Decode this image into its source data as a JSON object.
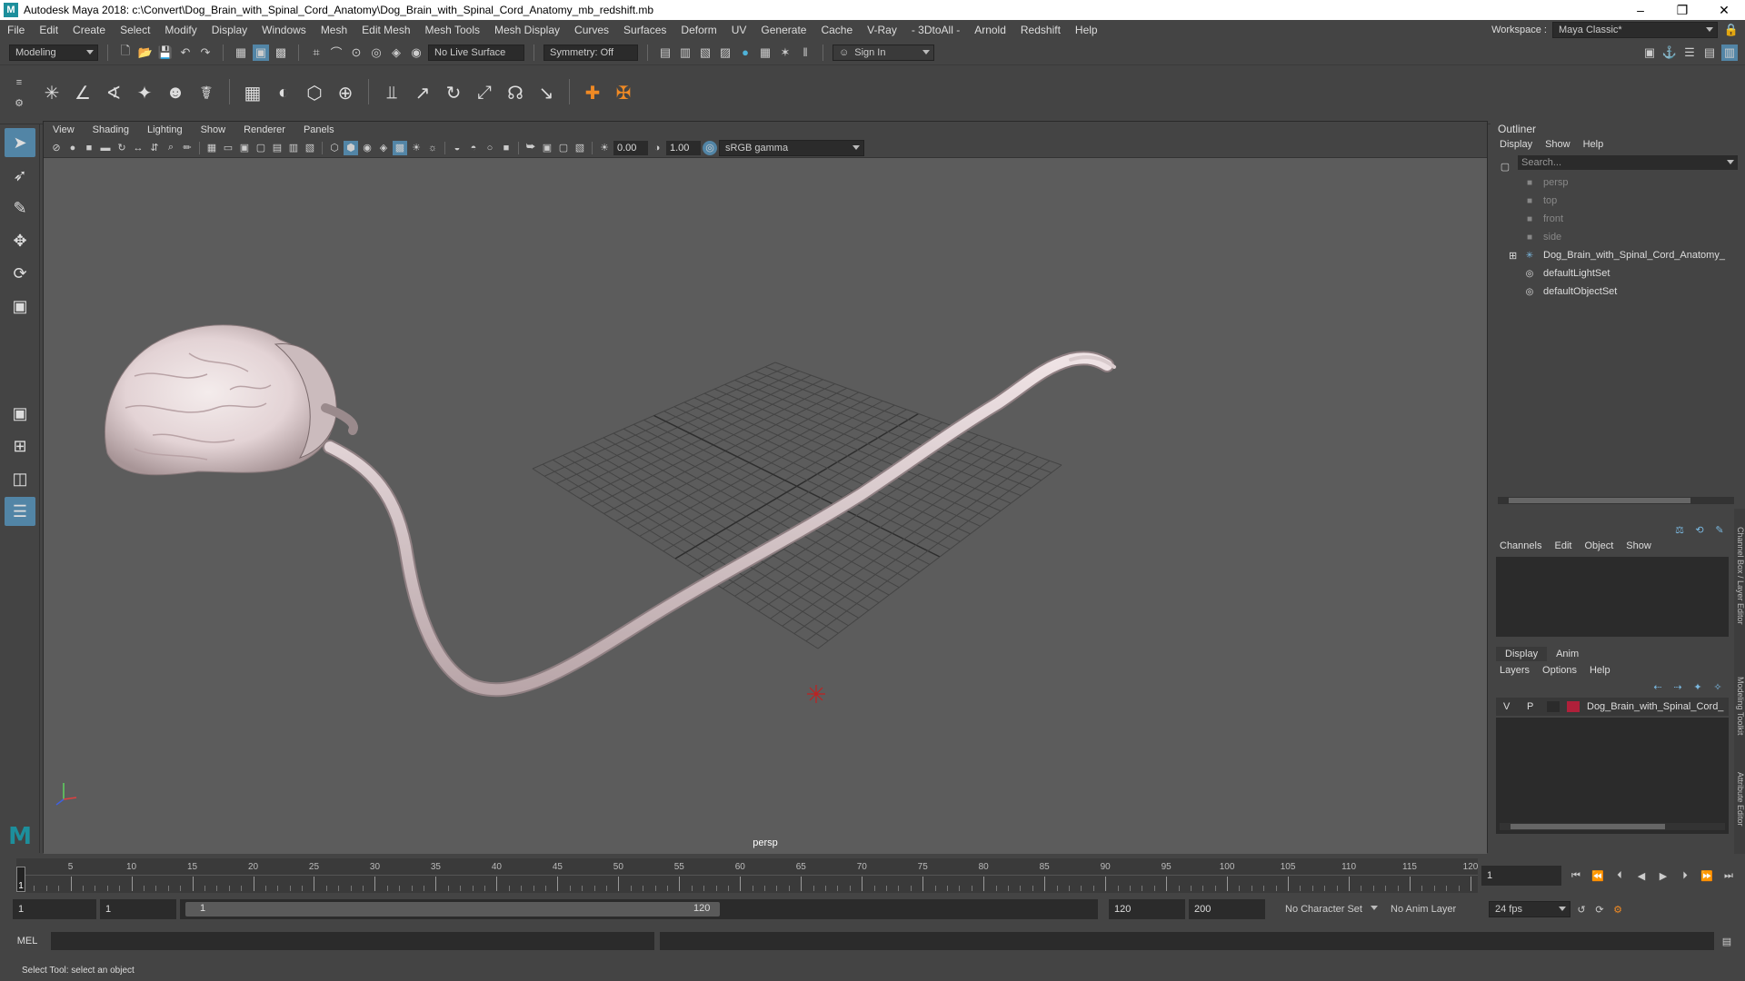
{
  "title": "Autodesk Maya 2018: c:\\Convert\\Dog_Brain_with_Spinal_Cord_Anatomy\\Dog_Brain_with_Spinal_Cord_Anatomy_mb_redshift.mb",
  "window_buttons": [
    "–",
    "❐",
    "✕"
  ],
  "menu": [
    "File",
    "Edit",
    "Create",
    "Select",
    "Modify",
    "Display",
    "Windows",
    "Mesh",
    "Edit Mesh",
    "Mesh Tools",
    "Mesh Display",
    "Curves",
    "Surfaces",
    "Deform",
    "UV",
    "Generate",
    "Cache",
    "V-Ray",
    "- 3DtoAll -",
    "Arnold",
    "Redshift",
    "Help"
  ],
  "workspace": {
    "label": "Workspace :",
    "value": "Maya Classic*"
  },
  "statusline": {
    "mode": "Modeling",
    "live_surface": "No Live Surface",
    "symmetry": "Symmetry: Off",
    "sign_in": "Sign In"
  },
  "viewport": {
    "menu": [
      "View",
      "Shading",
      "Lighting",
      "Show",
      "Renderer",
      "Panels"
    ],
    "exposure": "0.00",
    "gamma": "1.00",
    "color_space": "sRGB gamma",
    "camera": "persp"
  },
  "outliner": {
    "title": "Outliner",
    "menu": [
      "Display",
      "Show",
      "Help"
    ],
    "search_placeholder": "Search...",
    "items": [
      {
        "label": "persp",
        "icon": "camera-icon",
        "dim": true
      },
      {
        "label": "top",
        "icon": "camera-icon",
        "dim": true
      },
      {
        "label": "front",
        "icon": "camera-icon",
        "dim": true
      },
      {
        "label": "side",
        "icon": "camera-icon",
        "dim": true
      },
      {
        "label": "Dog_Brain_with_Spinal_Cord_Anatomy_",
        "icon": "transform-icon",
        "dim": false
      },
      {
        "label": "defaultLightSet",
        "icon": "set-icon",
        "dim": false
      },
      {
        "label": "defaultObjectSet",
        "icon": "set-icon",
        "dim": false
      }
    ]
  },
  "channelbox": {
    "menu": [
      "Channels",
      "Edit",
      "Object",
      "Show"
    ]
  },
  "layereditor": {
    "tabs": [
      "Display",
      "Anim"
    ],
    "menu": [
      "Layers",
      "Options",
      "Help"
    ],
    "layer": {
      "v": "V",
      "p": "P",
      "name": "Dog_Brain_with_Spinal_Cord_",
      "color": "#b0203a"
    }
  },
  "side_tabs": [
    "Channel Box / Layer Editor",
    "Modeling Toolkit",
    "Attribute Editor"
  ],
  "timeline": {
    "ticks": [
      5,
      10,
      15,
      20,
      25,
      30,
      35,
      40,
      45,
      50,
      55,
      60,
      65,
      70,
      75,
      80,
      85,
      90,
      95,
      100,
      105,
      110,
      115,
      120
    ],
    "current": "1",
    "current_field": "1"
  },
  "range": {
    "start": "1",
    "playback_start": "1",
    "slider_start": "1",
    "slider_end": "120",
    "playback_end": "120",
    "end": "200",
    "character_set": "No Character Set",
    "anim_layer": "No Anim Layer",
    "fps": "24 fps"
  },
  "cmdline": {
    "label": "MEL"
  },
  "helpline": "Select Tool: select an object",
  "colors": {
    "accent": "#5285a6",
    "maya_logo": "#1d8f9c"
  }
}
